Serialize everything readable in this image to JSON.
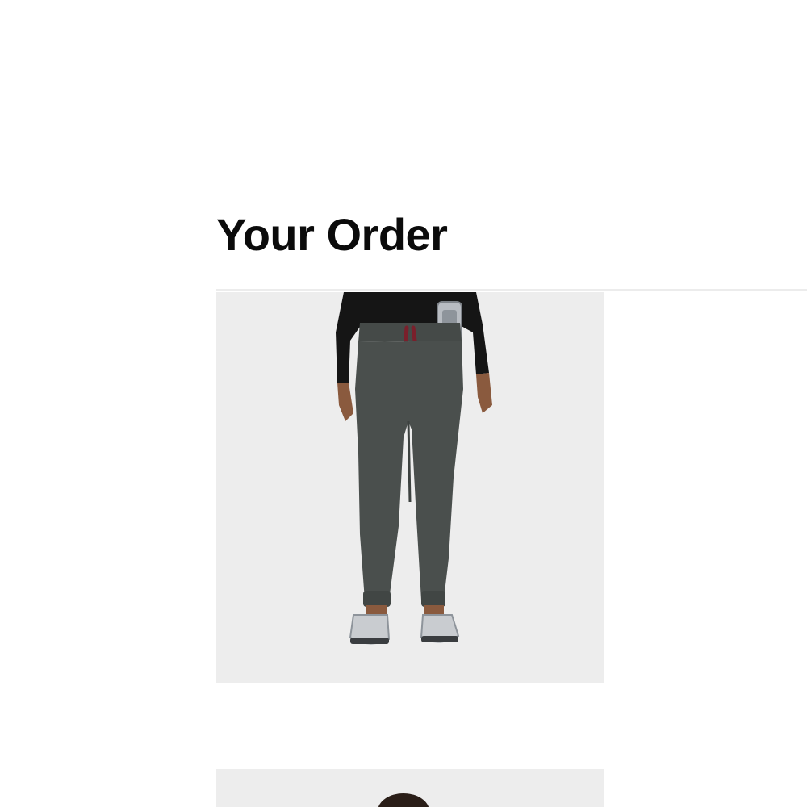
{
  "order": {
    "title": "Your Order",
    "items": [
      {
        "image": "product-photo-jogger-pants",
        "colors": {
          "pants": "#4a4f4d",
          "background": "#ededed",
          "drawstring": "#7a1f2b",
          "top": "#141414",
          "shoes": "#c9ccd0"
        }
      },
      {
        "image": "product-photo-partial",
        "colors": {
          "background": "#ededed",
          "hair": "#2a1e18"
        }
      }
    ]
  }
}
